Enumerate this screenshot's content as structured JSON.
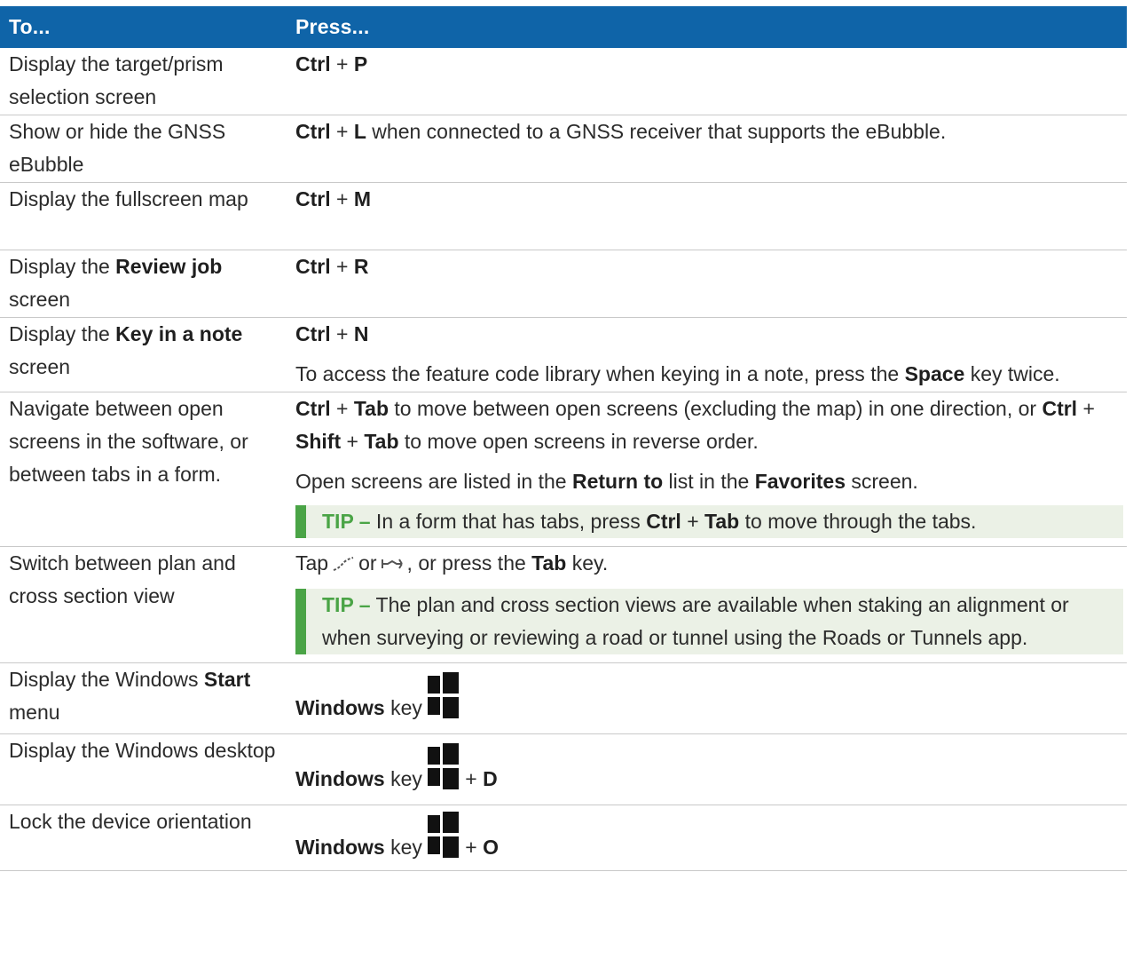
{
  "header": {
    "col1": "To...",
    "col2": "Press..."
  },
  "rows": [
    {
      "to": "Display the target/prism selection screen",
      "press": {
        "k1": "Ctrl",
        "plus": " + ",
        "k2": "P"
      }
    },
    {
      "to": "Show or hide the GNSS eBubble",
      "press": {
        "k1": "Ctrl",
        "plus": " + ",
        "k2": "L",
        "rest": " when connected to a GNSS receiver that supports the eBubble."
      }
    },
    {
      "to": "Display the fullscreen map",
      "press": {
        "k1": "Ctrl",
        "plus": " + ",
        "k2": "M"
      }
    },
    {
      "to_pre": "Display the ",
      "to_bold": "Review job",
      "to_post": " screen",
      "press": {
        "k1": "Ctrl",
        "plus": " + ",
        "k2": "R"
      }
    },
    {
      "to_pre": "Display the ",
      "to_bold": "Key in a note",
      "to_post": " screen",
      "press": {
        "k1": "Ctrl",
        "plus": " + ",
        "k2": "N"
      },
      "note": {
        "pre": "To access the feature code library when keying in a note, press the ",
        "bold": "Space",
        "post": " key twice."
      }
    },
    {
      "to": "Navigate between open screens in the software, or between tabs in a form.",
      "p1": {
        "k1": "Ctrl",
        "t1": " + ",
        "k2": "Tab",
        "t2": " to move between open screens (excluding the map) in one direction, or ",
        "k3": "Ctrl",
        "t3": " + ",
        "k4": "Shift",
        "t4": " + ",
        "k5": "Tab",
        "t5": " to move open screens in reverse order."
      },
      "p2": {
        "t1": "Open screens are listed in the ",
        "b1": "Return to",
        "t2": " list in the ",
        "b2": "Favorites",
        "t3": " screen."
      },
      "tip": {
        "label": "TIP –",
        "t1": " In a form that has tabs, press ",
        "k1": "Ctrl",
        "t2": " + ",
        "k2": "Tab",
        "t3": " to move through the tabs."
      }
    },
    {
      "to": "Switch between plan and cross section view",
      "p1": {
        "t1": "Tap",
        "t2": "or",
        "t3": ", or press the ",
        "k1": "Tab",
        "t4": " key.",
        "icon1": "plan-view-icon",
        "icon2": "cross-section-icon"
      },
      "tip": {
        "label": "TIP –",
        "text": " The plan and cross section views are available when staking an alignment or when surveying or reviewing a road or tunnel using the Roads or Tunnels app."
      }
    },
    {
      "to_pre": "Display the Windows ",
      "to_bold": "Start",
      "to_post": " menu",
      "press": {
        "k1": "Windows",
        "t1": " key",
        "icon": "windows-icon"
      }
    },
    {
      "to": "Display the Windows desktop",
      "press": {
        "k1": "Windows",
        "t1": " key",
        "t2": " + ",
        "k2": "D",
        "icon": "windows-icon"
      }
    },
    {
      "to": "Lock the device orientation",
      "press": {
        "k1": "Windows",
        "t1": " key",
        "t2": " + ",
        "k2": "O",
        "icon": "windows-icon"
      }
    }
  ],
  "colors": {
    "header_bg": "#0f64a8",
    "tip_bg": "#ebf1e6",
    "tip_accent": "#4aa446"
  }
}
